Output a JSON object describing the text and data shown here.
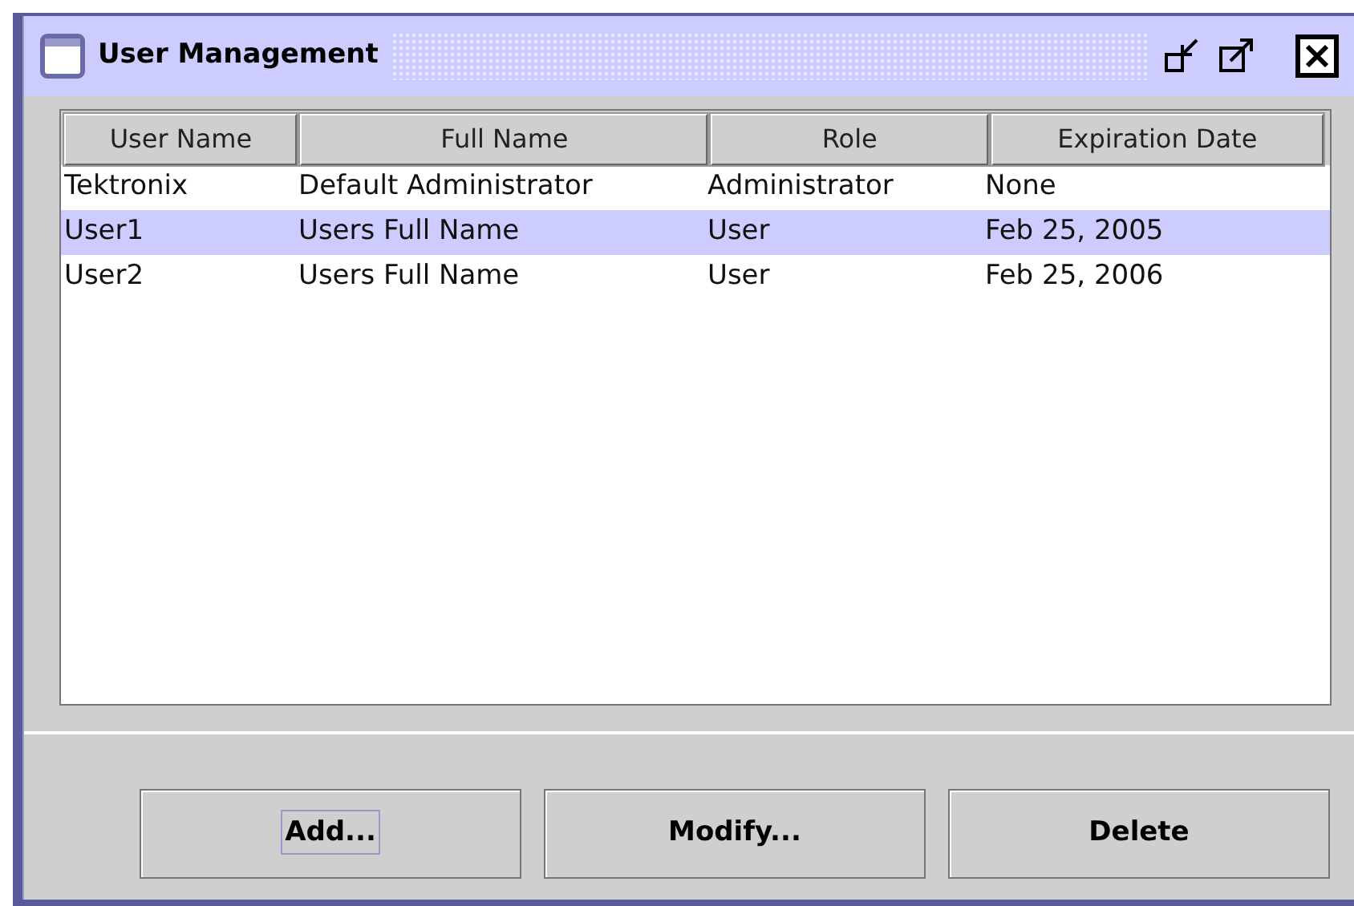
{
  "window": {
    "title": "User Management"
  },
  "table": {
    "columns": [
      "User Name",
      "Full Name",
      "Role",
      "Expiration Date"
    ],
    "rows": [
      {
        "cells": [
          "Tektronix",
          "Default Administrator",
          "Administrator",
          "None"
        ],
        "selected": false
      },
      {
        "cells": [
          "User1",
          "Users Full Name",
          "User",
          "Feb 25, 2005"
        ],
        "selected": true
      },
      {
        "cells": [
          "User2",
          "Users Full Name",
          "User",
          "Feb 25, 2006"
        ],
        "selected": false
      }
    ]
  },
  "buttons": [
    {
      "label": "Add...",
      "focused": true
    },
    {
      "label": "Modify...",
      "focused": false
    },
    {
      "label": "Delete",
      "focused": false
    }
  ]
}
